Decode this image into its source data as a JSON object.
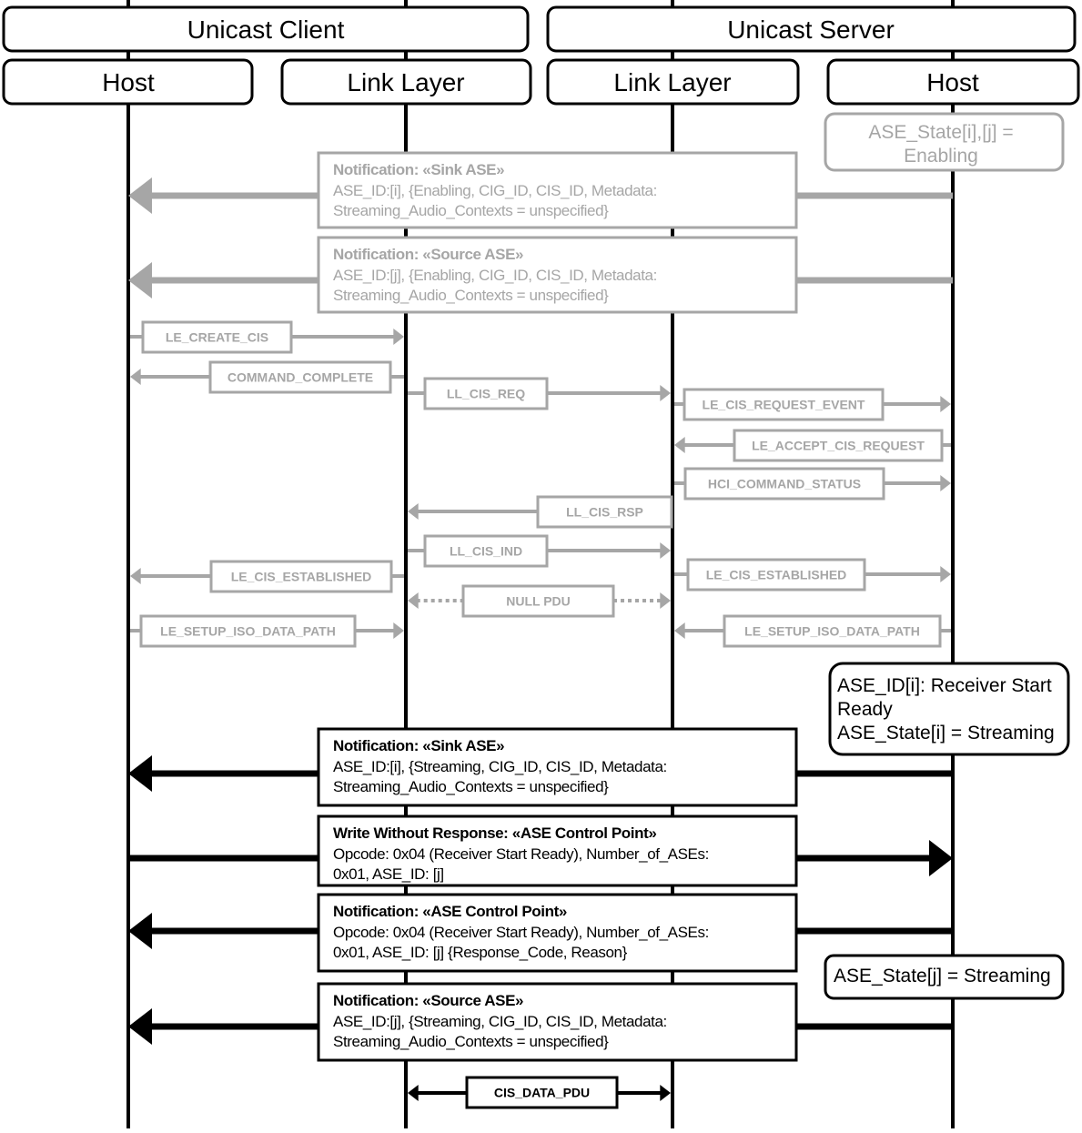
{
  "colors": {
    "active": "#000000",
    "inactive": "#a6a6a6",
    "background": "#ffffff"
  },
  "groups": [
    {
      "label": "Unicast Client"
    },
    {
      "label": "Unicast Server"
    }
  ],
  "lifelines": [
    {
      "id": "client_host",
      "label": "Host"
    },
    {
      "id": "client_ll",
      "label": "Link Layer"
    },
    {
      "id": "server_ll",
      "label": "Link Layer"
    },
    {
      "id": "server_host",
      "label": "Host"
    }
  ],
  "states": [
    {
      "lines": [
        "ASE_State[i],[j] =",
        "Enabling"
      ],
      "status": "inactive",
      "align": "center"
    },
    {
      "lines": [
        "ASE_ID[i]: Receiver Start",
        "Ready",
        "ASE_State[i] = Streaming"
      ],
      "status": "active",
      "align": "left"
    },
    {
      "lines": [
        "ASE_State[j] = Streaming"
      ],
      "status": "active",
      "align": "left"
    }
  ],
  "att_messages": [
    {
      "title": "Notification: «Sink ASE»",
      "body": [
        "ASE_ID:[i], {Enabling, CIG_ID, CIS_ID, Metadata:",
        "Streaming_Audio_Contexts = unspecified}"
      ],
      "from": "server_host",
      "to": "client_host",
      "status": "inactive"
    },
    {
      "title": "Notification: «Source ASE»",
      "body": [
        "ASE_ID:[j], {Enabling, CIG_ID, CIS_ID, Metadata:",
        "Streaming_Audio_Contexts = unspecified}"
      ],
      "from": "server_host",
      "to": "client_host",
      "status": "inactive"
    },
    {
      "title": "Notification: «Sink ASE»",
      "body": [
        "ASE_ID:[i], {Streaming, CIG_ID, CIS_ID, Metadata:",
        "Streaming_Audio_Contexts = unspecified}"
      ],
      "from": "server_host",
      "to": "client_host",
      "status": "active"
    },
    {
      "title": "Write Without Response: «ASE Control Point»",
      "body": [
        "Opcode: 0x04 (Receiver Start Ready), Number_of_ASEs:",
        "0x01, ASE_ID: [j]"
      ],
      "from": "client_host",
      "to": "server_host",
      "status": "active"
    },
    {
      "title": "Notification: «ASE Control Point»",
      "body": [
        "Opcode: 0x04 (Receiver Start Ready), Number_of_ASEs:",
        "0x01, ASE_ID: [j] {Response_Code, Reason}"
      ],
      "from": "server_host",
      "to": "client_host",
      "status": "active"
    },
    {
      "title": "Notification: «Source ASE»",
      "body": [
        "ASE_ID:[j], {Streaming, CIG_ID, CIS_ID, Metadata:",
        "Streaming_Audio_Contexts = unspecified}"
      ],
      "from": "server_host",
      "to": "client_host",
      "status": "active"
    }
  ],
  "hci_messages": [
    {
      "label": "LE_CREATE_CIS",
      "from": "client_host",
      "to": "client_ll",
      "status": "inactive",
      "style": "solid"
    },
    {
      "label": "COMMAND_COMPLETE",
      "from": "client_ll",
      "to": "client_host",
      "status": "inactive",
      "style": "solid"
    },
    {
      "label": "LL_CIS_REQ",
      "from": "client_ll",
      "to": "server_ll",
      "status": "inactive",
      "style": "solid"
    },
    {
      "label": "LE_CIS_REQUEST_EVENT",
      "from": "server_ll",
      "to": "server_host",
      "status": "inactive",
      "style": "solid"
    },
    {
      "label": "LE_ACCEPT_CIS_REQUEST",
      "from": "server_host",
      "to": "server_ll",
      "status": "inactive",
      "style": "solid"
    },
    {
      "label": "HCI_COMMAND_STATUS",
      "from": "server_ll",
      "to": "server_host",
      "status": "inactive",
      "style": "solid"
    },
    {
      "label": "LL_CIS_RSP",
      "from": "server_ll",
      "to": "client_ll",
      "status": "inactive",
      "style": "solid"
    },
    {
      "label": "LL_CIS_IND",
      "from": "client_ll",
      "to": "server_ll",
      "status": "inactive",
      "style": "solid"
    },
    {
      "label": "LE_CIS_ESTABLISHED",
      "from": "client_ll",
      "to": "client_host",
      "status": "inactive",
      "style": "solid"
    },
    {
      "label": "LE_CIS_ESTABLISHED",
      "from": "server_ll",
      "to": "server_host",
      "status": "inactive",
      "style": "solid"
    },
    {
      "label": "NULL PDU",
      "from": "client_ll",
      "to": "server_ll",
      "status": "inactive",
      "style": "dotted-bidirectional"
    },
    {
      "label": "LE_SETUP_ISO_DATA_PATH",
      "from": "client_host",
      "to": "client_ll",
      "status": "inactive",
      "style": "solid"
    },
    {
      "label": "LE_SETUP_ISO_DATA_PATH",
      "from": "server_host",
      "to": "server_ll",
      "status": "inactive",
      "style": "solid"
    },
    {
      "label": "CIS_DATA_PDU",
      "from": "client_ll",
      "to": "server_ll",
      "status": "active",
      "style": "bidirectional"
    }
  ]
}
